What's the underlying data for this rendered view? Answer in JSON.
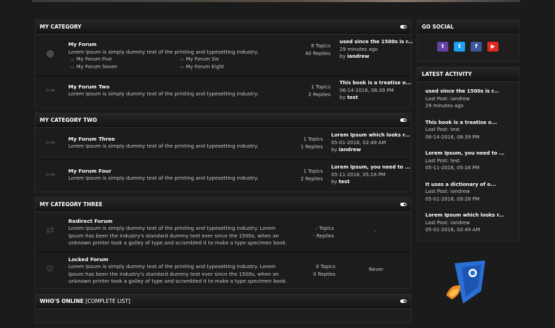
{
  "categories": [
    {
      "title": "My Category",
      "forums": [
        {
          "title": "My Forum",
          "description": "Lorem Ipsum is simply dummy text of the printing and typesetting industry.",
          "subforums": [
            "My Forum Five",
            "My Forum Six",
            "My Forum Seven",
            "My Forum Eight"
          ],
          "topics": "8 Topics",
          "replies": "40 Replies",
          "last_title": "used since the 1500s is r...",
          "last_time": "29 minutes ago",
          "last_by": "by",
          "last_user": "iandrew"
        },
        {
          "title": "My Forum Two",
          "description": "Lorem Ipsum is simply dummy text of the printing and typesetting industry.",
          "topics": "1 Topics",
          "replies": "2 Replies",
          "last_title": "This book is a treatise o...",
          "last_time": "06-14-2016, 08:39 PM",
          "last_by": "by",
          "last_user": "test"
        }
      ]
    },
    {
      "title": "My Category Two",
      "forums": [
        {
          "title": "My Forum Three",
          "description": "Lorem Ipsum is simply dummy text of the printing and typesetting industry.",
          "topics": "1 Topics",
          "replies": "1 Replies",
          "last_title": "Lorem Ipsum which looks r...",
          "last_time": "05-01-2016, 02:49 AM",
          "last_by": "by",
          "last_user": "iandrew"
        },
        {
          "title": "My Forum Four",
          "description": "Lorem Ipsum is simply dummy text of the printing and typesetting industry.",
          "topics": "1 Topics",
          "replies": "2 Replies",
          "last_title": "Lorem Ipsum, you need to ...",
          "last_time": "05-11-2016, 05:16 PM",
          "last_by": "by",
          "last_user": "test"
        }
      ]
    },
    {
      "title": "My Category Three",
      "forums": [
        {
          "title": "Redirect Forum",
          "description": "Lorem Ipsum is simply dummy text of the printing and typesetting industry. Lorem Ipsum has been the industry's standard dummy text ever since the 1500s, when an unknown printer took a galley of type and scrambled it to make a type specimen book.",
          "topics": "- Topics",
          "replies": "- Replies",
          "last": "-"
        },
        {
          "title": "Locked Forum",
          "description": "Lorem Ipsum is simply dummy text of the printing and typesetting industry. Lorem Ipsum has been the industry's standard dummy text ever since the 1500s, when an unknown printer took a galley of type and scrambled it to make a type specimen book.",
          "topics": "0 Topics",
          "replies": "0 Replies",
          "last": "Never"
        }
      ]
    }
  ],
  "whos_online": {
    "title": "Who's Online",
    "link": "[Complete List]"
  },
  "social": {
    "title": "Go Social",
    "buttons": [
      {
        "name": "twitch",
        "glyph": "t",
        "color": "#6441a5"
      },
      {
        "name": "twitter",
        "glyph": "t",
        "color": "#1da1f2"
      },
      {
        "name": "facebook",
        "glyph": "f",
        "color": "#3b5998"
      },
      {
        "name": "youtube",
        "glyph": "▶",
        "color": "#e02a20"
      }
    ]
  },
  "latest": {
    "title": "Latest Activity",
    "items": [
      {
        "title": "used since the 1500s is r...",
        "last_post": "Last Post: iandrew",
        "time": "29 minutes ago"
      },
      {
        "title": "This book is a treatise o...",
        "last_post": "Last Post: test",
        "time": "06-14-2016, 08:39 PM"
      },
      {
        "title": "Lorem Ipsum, you need to ...",
        "last_post": "Last Post: test",
        "time": "05-11-2016, 05:16 PM"
      },
      {
        "title": "It uses a dictionary of o...",
        "last_post": "Last Post: iandrew",
        "time": "05-01-2016, 09:28 PM"
      },
      {
        "title": "Lorem Ipsum which looks r...",
        "last_post": "Last Post: iandrew",
        "time": "05-01-2016, 02:49 AM"
      }
    ]
  }
}
